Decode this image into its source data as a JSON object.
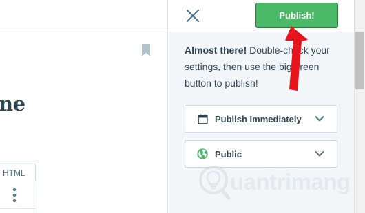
{
  "editor": {
    "heading_fragment": "ne",
    "html_tab_label": "HTML"
  },
  "panel": {
    "publish_label": "Publish!",
    "intro_bold": "Almost there!",
    "intro_text": " Double-check your settings, then use the big green button to publish!",
    "schedule_label": "Publish Immediately",
    "visibility_label": "Public"
  },
  "watermark": {
    "text": "uantrimang"
  },
  "colors": {
    "publish_green": "#4ab866",
    "annotation_red": "#e8141c",
    "panel_bg": "#f3f6f8",
    "text_dark": "#2e4453"
  },
  "icons": {
    "close": "close-icon",
    "calendar": "calendar-icon",
    "globe": "globe-icon",
    "chevron": "chevron-down-icon",
    "bookmark": "bookmark-icon",
    "kebab": "more-vertical-icon"
  }
}
